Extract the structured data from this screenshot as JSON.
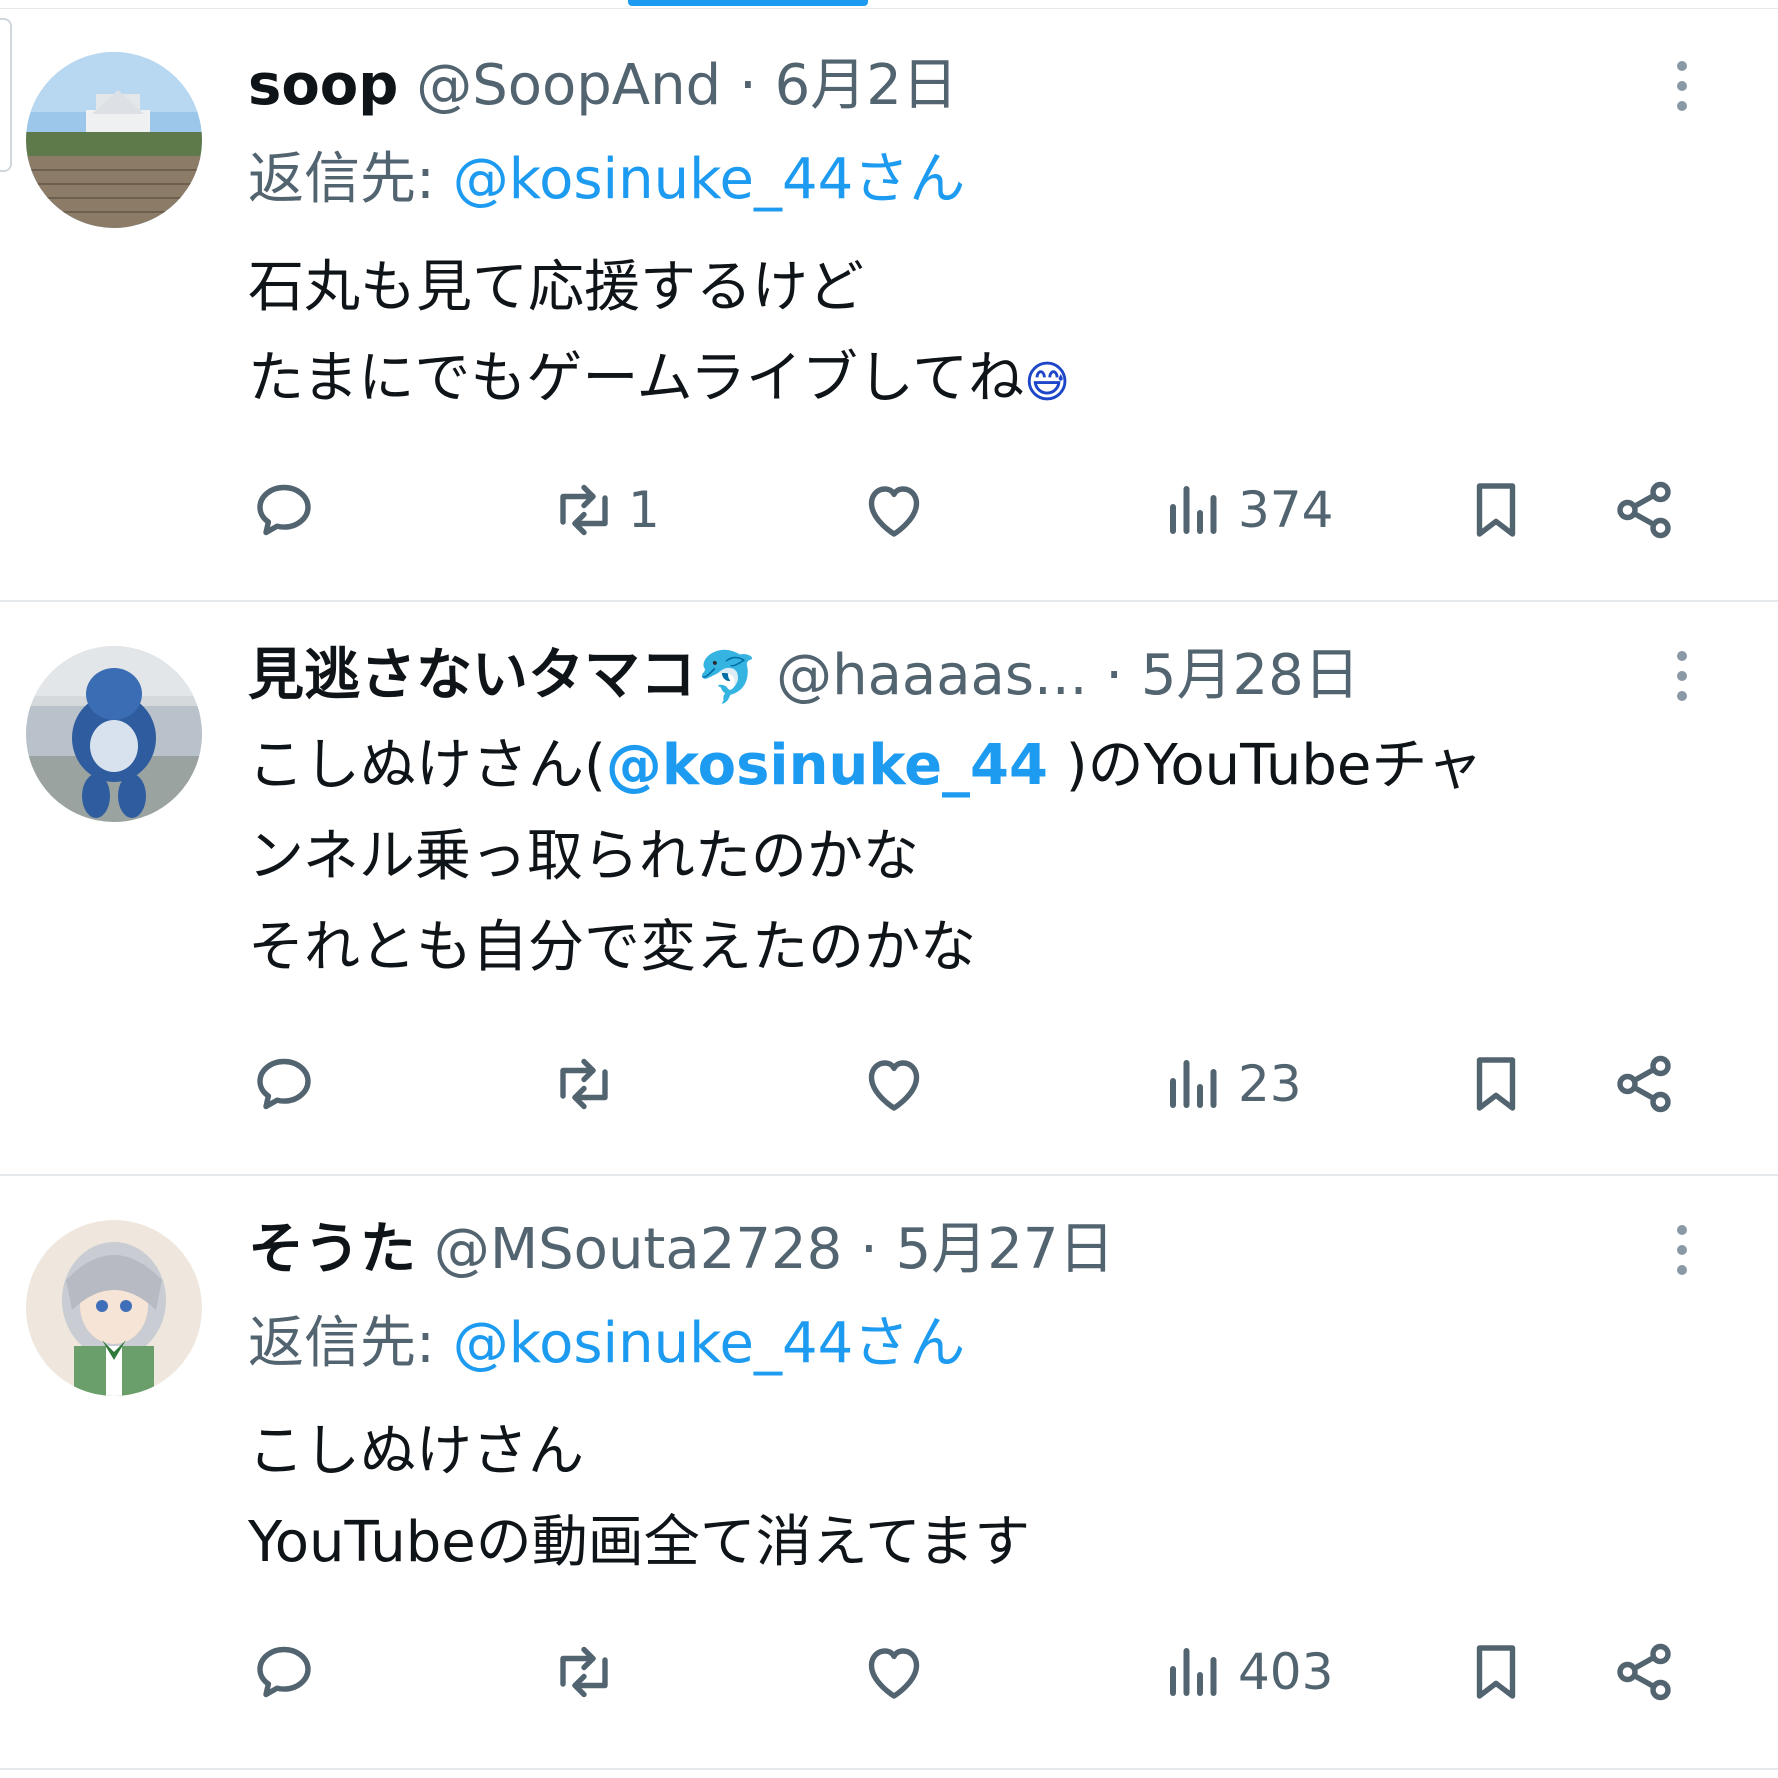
{
  "tweets": [
    {
      "name": "soop",
      "handle": "@SoopAnd",
      "separator": "·",
      "date": "6月2日",
      "reply_prefix": "返信先:",
      "reply_mention": "@kosinuke_44さん",
      "lines": [
        "石丸も見て応援するけど",
        "たまにでもゲームライブしてね"
      ],
      "emoji": "😅",
      "retweets": "1",
      "views": "374"
    },
    {
      "name": "見逃さないタマコ",
      "name_emoji": "🐬",
      "handle": "@haaaas...",
      "separator": "·",
      "date": "5月28日",
      "line1_pre": "こしぬけさん(",
      "line1_mention": "@kosinuke_44",
      "line1_post": " )のYouTubeチャ",
      "lines": [
        "ンネル乗っ取られたのかな",
        "それとも自分で変えたのかな"
      ],
      "views": "23"
    },
    {
      "name": "そうた",
      "handle": "@MSouta2728",
      "separator": "·",
      "date": "5月27日",
      "reply_prefix": "返信先:",
      "reply_mention": "@kosinuke_44さん",
      "lines": [
        "こしぬけさん",
        "YouTubeの動画全て消えてます"
      ],
      "views": "403"
    }
  ],
  "icons": [
    "reply-icon",
    "retweet-icon",
    "like-icon",
    "views-icon",
    "bookmark-icon",
    "share-icon",
    "more-icon"
  ],
  "colors": {
    "accent": "#1d9bf0",
    "secondary_text": "#536471",
    "icon": "#536471",
    "divider": "#e6e9ec"
  }
}
